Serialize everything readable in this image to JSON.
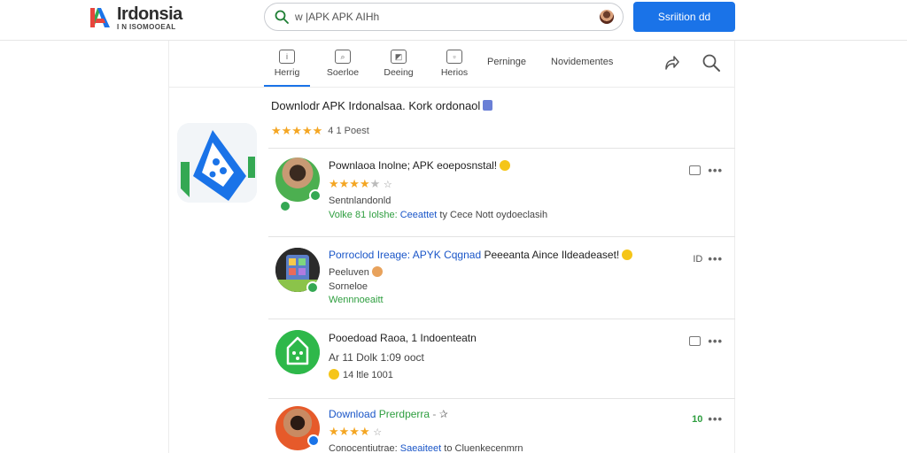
{
  "header": {
    "logo_title": "Irdonsia",
    "logo_subtitle": "I N ISOMOOEAL",
    "search_value": "w |APK APK AIHh",
    "cta_label": "Ssriition dd"
  },
  "nav": {
    "tabs": [
      {
        "label": "Herrig",
        "icon": "home-icon",
        "glyph": "i"
      },
      {
        "label": "Soerloe",
        "icon": "search-icon",
        "glyph": "⌕"
      },
      {
        "label": "Deeing",
        "icon": "image-icon",
        "glyph": "◩"
      },
      {
        "label": "Herios",
        "icon": "grid-icon",
        "glyph": "▫"
      }
    ],
    "text_links": [
      "Perninge",
      "Novidementes"
    ]
  },
  "app": {
    "title": "Downlodr APK Irdonalsaa. Kork ordonaol",
    "rating": 4.5,
    "reviews": "4 1 Poest"
  },
  "rows": [
    {
      "title": "Pownlaoa Inolne; APK eoeposnstal!",
      "rating": 4,
      "line1": "Sentnlandonld",
      "line2_a": "Volke 81 Iolshe:",
      "line2_b": "Ceeattet",
      "line2_c": "ty Cece Nott oydoeclasih",
      "count": ""
    },
    {
      "title_a": "Porroclod Ireage:",
      "title_b": "APYK Cqgnad",
      "title_c": "Peeeanta Aince Ildeadeaset!",
      "line1": "Peeluven",
      "line2": "Sorneloe",
      "line3": "Wennnoeaitt",
      "count": "ID"
    },
    {
      "title": "Pooedoad Raoa, 1 Indoenteatn",
      "line1": "Ar 11 Dolk 1:09 ooct",
      "line2": "14 ltle 1001",
      "count": ""
    },
    {
      "title_a": "Download",
      "title_b": "Prerdperra",
      "title_c": "- ✰",
      "rating": 4,
      "line1_a": "Conocentiutrae:",
      "line1_b": "Saeaiteet",
      "line1_c": "to Cluenkecenmrn",
      "count": "10"
    }
  ],
  "colors": {
    "brand_blue": "#1a73e8",
    "star": "#f4a623",
    "verified_green": "#34a853"
  }
}
